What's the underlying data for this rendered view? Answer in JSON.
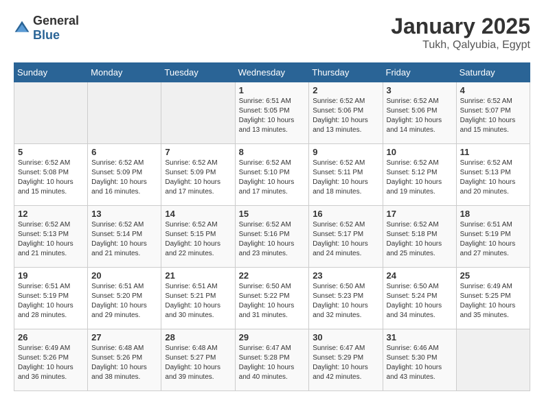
{
  "header": {
    "logo_general": "General",
    "logo_blue": "Blue",
    "title": "January 2025",
    "subtitle": "Tukh, Qalyubia, Egypt"
  },
  "weekdays": [
    "Sunday",
    "Monday",
    "Tuesday",
    "Wednesday",
    "Thursday",
    "Friday",
    "Saturday"
  ],
  "weeks": [
    [
      {
        "day": "",
        "info": ""
      },
      {
        "day": "",
        "info": ""
      },
      {
        "day": "",
        "info": ""
      },
      {
        "day": "1",
        "info": "Sunrise: 6:51 AM\nSunset: 5:05 PM\nDaylight: 10 hours\nand 13 minutes."
      },
      {
        "day": "2",
        "info": "Sunrise: 6:52 AM\nSunset: 5:06 PM\nDaylight: 10 hours\nand 13 minutes."
      },
      {
        "day": "3",
        "info": "Sunrise: 6:52 AM\nSunset: 5:06 PM\nDaylight: 10 hours\nand 14 minutes."
      },
      {
        "day": "4",
        "info": "Sunrise: 6:52 AM\nSunset: 5:07 PM\nDaylight: 10 hours\nand 15 minutes."
      }
    ],
    [
      {
        "day": "5",
        "info": "Sunrise: 6:52 AM\nSunset: 5:08 PM\nDaylight: 10 hours\nand 15 minutes."
      },
      {
        "day": "6",
        "info": "Sunrise: 6:52 AM\nSunset: 5:09 PM\nDaylight: 10 hours\nand 16 minutes."
      },
      {
        "day": "7",
        "info": "Sunrise: 6:52 AM\nSunset: 5:09 PM\nDaylight: 10 hours\nand 17 minutes."
      },
      {
        "day": "8",
        "info": "Sunrise: 6:52 AM\nSunset: 5:10 PM\nDaylight: 10 hours\nand 17 minutes."
      },
      {
        "day": "9",
        "info": "Sunrise: 6:52 AM\nSunset: 5:11 PM\nDaylight: 10 hours\nand 18 minutes."
      },
      {
        "day": "10",
        "info": "Sunrise: 6:52 AM\nSunset: 5:12 PM\nDaylight: 10 hours\nand 19 minutes."
      },
      {
        "day": "11",
        "info": "Sunrise: 6:52 AM\nSunset: 5:13 PM\nDaylight: 10 hours\nand 20 minutes."
      }
    ],
    [
      {
        "day": "12",
        "info": "Sunrise: 6:52 AM\nSunset: 5:13 PM\nDaylight: 10 hours\nand 21 minutes."
      },
      {
        "day": "13",
        "info": "Sunrise: 6:52 AM\nSunset: 5:14 PM\nDaylight: 10 hours\nand 21 minutes."
      },
      {
        "day": "14",
        "info": "Sunrise: 6:52 AM\nSunset: 5:15 PM\nDaylight: 10 hours\nand 22 minutes."
      },
      {
        "day": "15",
        "info": "Sunrise: 6:52 AM\nSunset: 5:16 PM\nDaylight: 10 hours\nand 23 minutes."
      },
      {
        "day": "16",
        "info": "Sunrise: 6:52 AM\nSunset: 5:17 PM\nDaylight: 10 hours\nand 24 minutes."
      },
      {
        "day": "17",
        "info": "Sunrise: 6:52 AM\nSunset: 5:18 PM\nDaylight: 10 hours\nand 25 minutes."
      },
      {
        "day": "18",
        "info": "Sunrise: 6:51 AM\nSunset: 5:19 PM\nDaylight: 10 hours\nand 27 minutes."
      }
    ],
    [
      {
        "day": "19",
        "info": "Sunrise: 6:51 AM\nSunset: 5:19 PM\nDaylight: 10 hours\nand 28 minutes."
      },
      {
        "day": "20",
        "info": "Sunrise: 6:51 AM\nSunset: 5:20 PM\nDaylight: 10 hours\nand 29 minutes."
      },
      {
        "day": "21",
        "info": "Sunrise: 6:51 AM\nSunset: 5:21 PM\nDaylight: 10 hours\nand 30 minutes."
      },
      {
        "day": "22",
        "info": "Sunrise: 6:50 AM\nSunset: 5:22 PM\nDaylight: 10 hours\nand 31 minutes."
      },
      {
        "day": "23",
        "info": "Sunrise: 6:50 AM\nSunset: 5:23 PM\nDaylight: 10 hours\nand 32 minutes."
      },
      {
        "day": "24",
        "info": "Sunrise: 6:50 AM\nSunset: 5:24 PM\nDaylight: 10 hours\nand 34 minutes."
      },
      {
        "day": "25",
        "info": "Sunrise: 6:49 AM\nSunset: 5:25 PM\nDaylight: 10 hours\nand 35 minutes."
      }
    ],
    [
      {
        "day": "26",
        "info": "Sunrise: 6:49 AM\nSunset: 5:26 PM\nDaylight: 10 hours\nand 36 minutes."
      },
      {
        "day": "27",
        "info": "Sunrise: 6:48 AM\nSunset: 5:26 PM\nDaylight: 10 hours\nand 38 minutes."
      },
      {
        "day": "28",
        "info": "Sunrise: 6:48 AM\nSunset: 5:27 PM\nDaylight: 10 hours\nand 39 minutes."
      },
      {
        "day": "29",
        "info": "Sunrise: 6:47 AM\nSunset: 5:28 PM\nDaylight: 10 hours\nand 40 minutes."
      },
      {
        "day": "30",
        "info": "Sunrise: 6:47 AM\nSunset: 5:29 PM\nDaylight: 10 hours\nand 42 minutes."
      },
      {
        "day": "31",
        "info": "Sunrise: 6:46 AM\nSunset: 5:30 PM\nDaylight: 10 hours\nand 43 minutes."
      },
      {
        "day": "",
        "info": ""
      }
    ]
  ]
}
